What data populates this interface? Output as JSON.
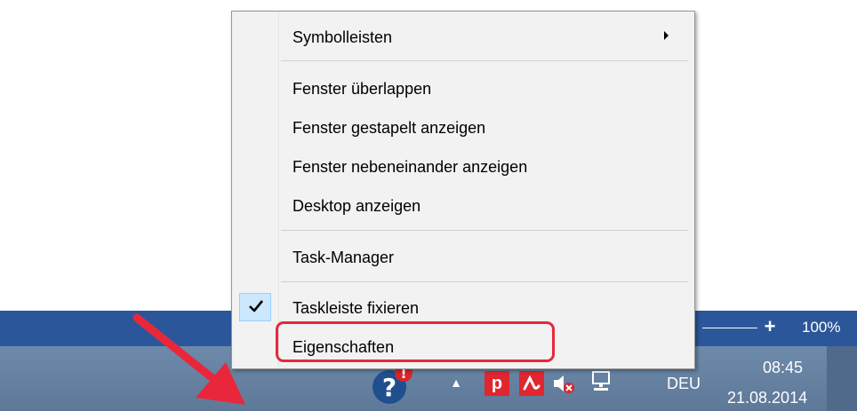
{
  "statusbar": {
    "zoom_plus": "+",
    "zoom_level": "100%",
    "color": "#2b579a"
  },
  "context_menu": {
    "items": [
      {
        "label": "Symbolleisten",
        "has_submenu": true
      },
      {
        "label": "Fenster überlappen"
      },
      {
        "label": "Fenster gestapelt anzeigen"
      },
      {
        "label": "Fenster nebeneinander anzeigen"
      },
      {
        "label": "Desktop anzeigen"
      },
      {
        "label": "Task-Manager"
      },
      {
        "label": "Taskleiste fixieren",
        "checked": true
      },
      {
        "label": "Eigenschaften",
        "highlighted": true
      }
    ]
  },
  "taskbar": {
    "tray_icons": [
      "help-icon",
      "show-hidden-icons-arrow",
      "p-app-icon",
      "avira-icon",
      "volume-muted-icon",
      "network-icon"
    ],
    "p_icon_letter": "p",
    "tray_arrow": "▲",
    "language": "DEU",
    "time": "08:45",
    "date": "21.08.2014"
  },
  "annotation": {
    "ring_color": "#e8283a",
    "arrow_color": "#e8283a"
  }
}
